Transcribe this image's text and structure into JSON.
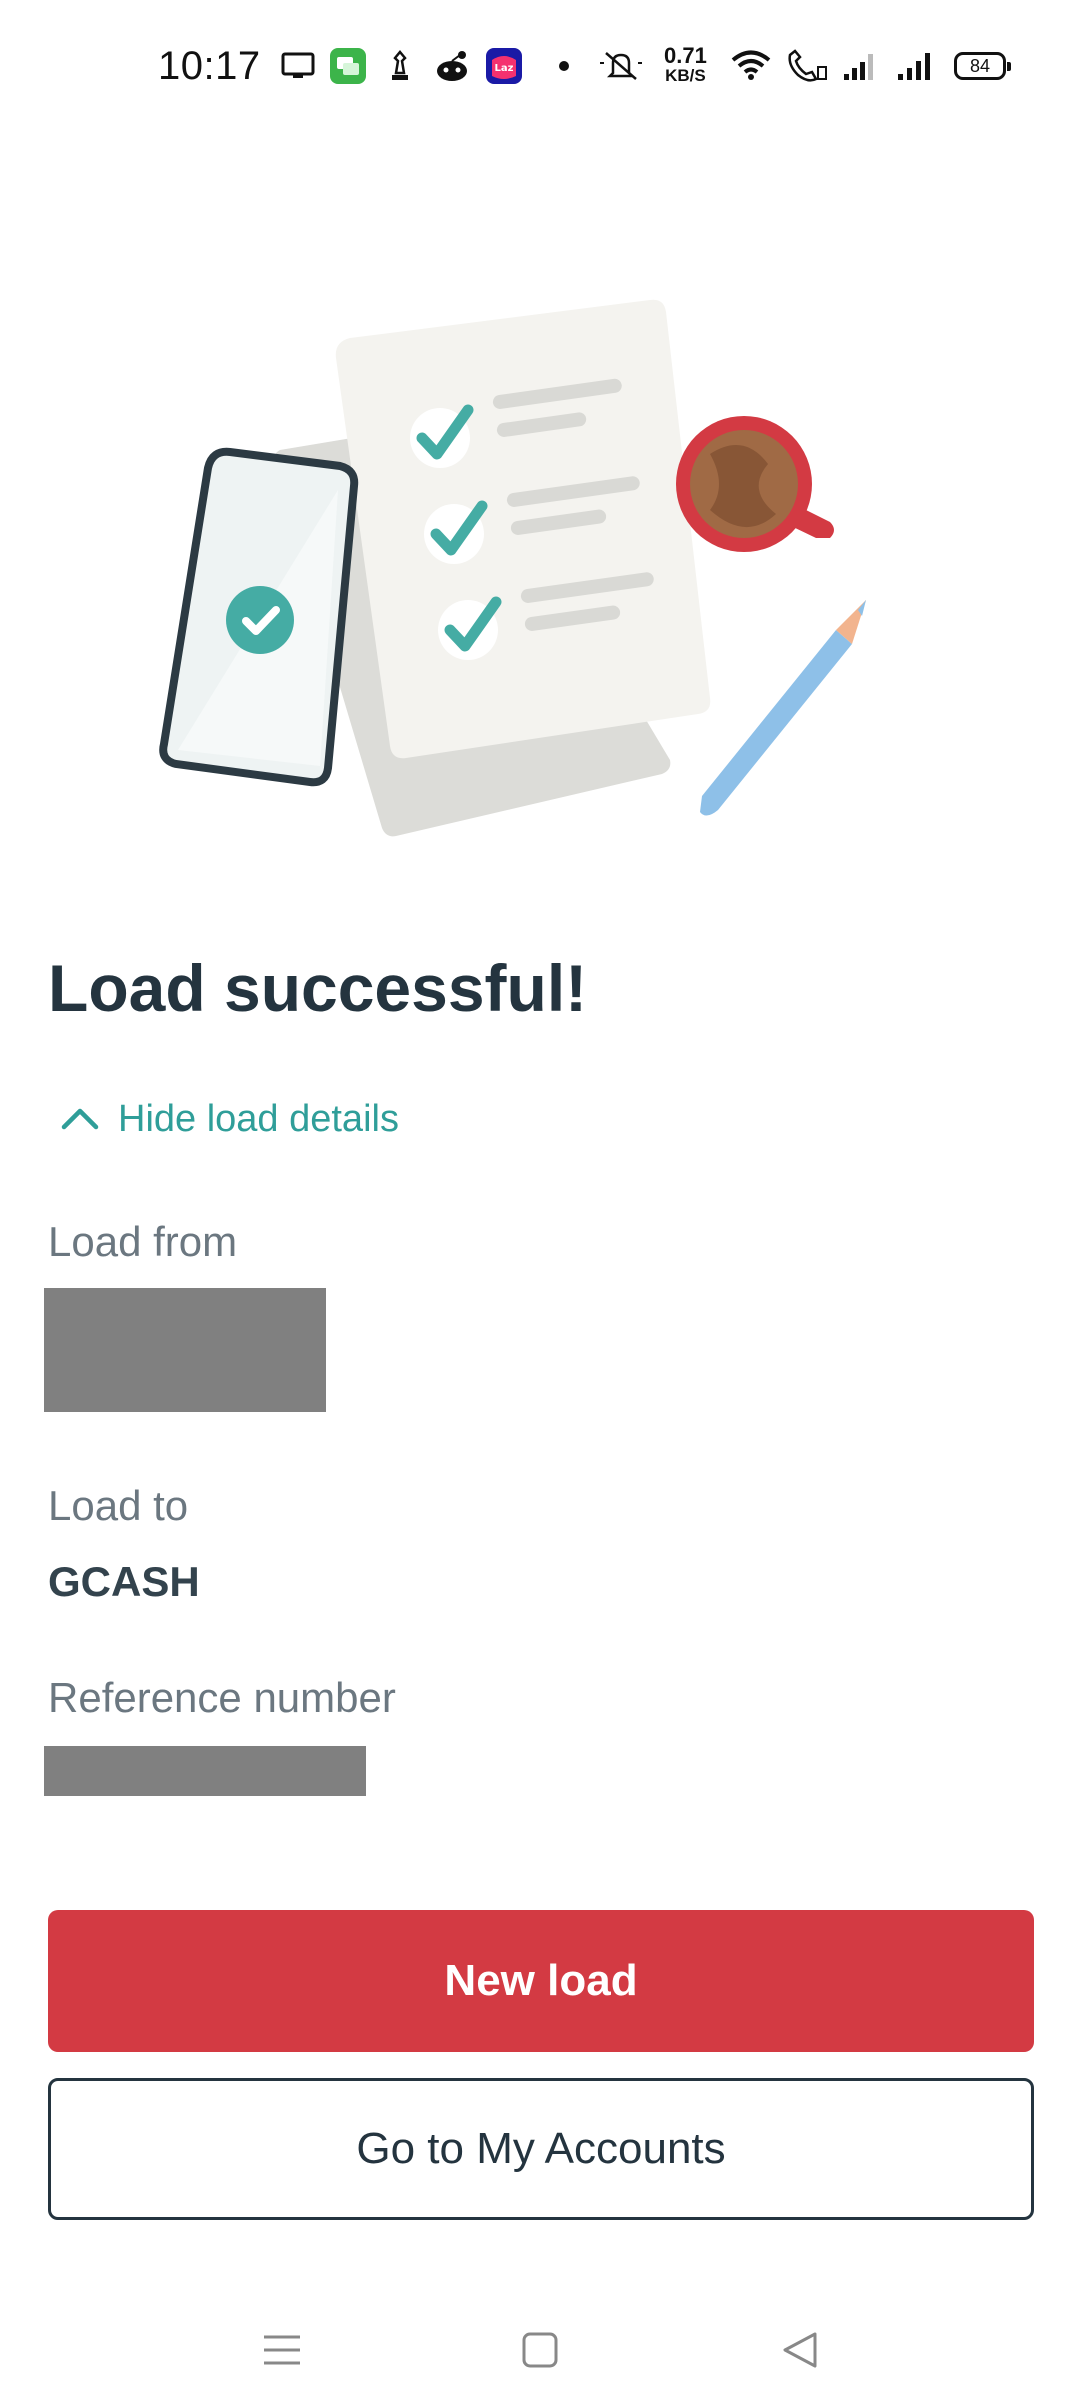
{
  "status_bar": {
    "time": "10:17",
    "net_speed_value": "0.71",
    "net_speed_unit": "KB/S",
    "battery": "84",
    "icons": [
      "screen-icon",
      "messages-icon",
      "chess-icon",
      "reddit-icon",
      "lazada-icon",
      "dot-icon",
      "mute-icon",
      "wifi-icon",
      "wifi-call-icon",
      "signal-1-icon",
      "signal-2-icon",
      "battery-icon"
    ]
  },
  "hero": {
    "illustration": "checklist-with-phone-and-coffee"
  },
  "result": {
    "title": "Load successful!",
    "toggle_label": "Hide load details"
  },
  "details": {
    "load_from_label": "Load from",
    "load_to_label": "Load to",
    "load_to_value": "GCASH",
    "reference_label": "Reference number"
  },
  "actions": {
    "primary_label": "New load",
    "secondary_label": "Go to My Accounts"
  },
  "colors": {
    "accent_red": "#d33a43",
    "teal": "#2f9e99",
    "text_dark": "#24343f",
    "text_muted": "#6b7780"
  }
}
